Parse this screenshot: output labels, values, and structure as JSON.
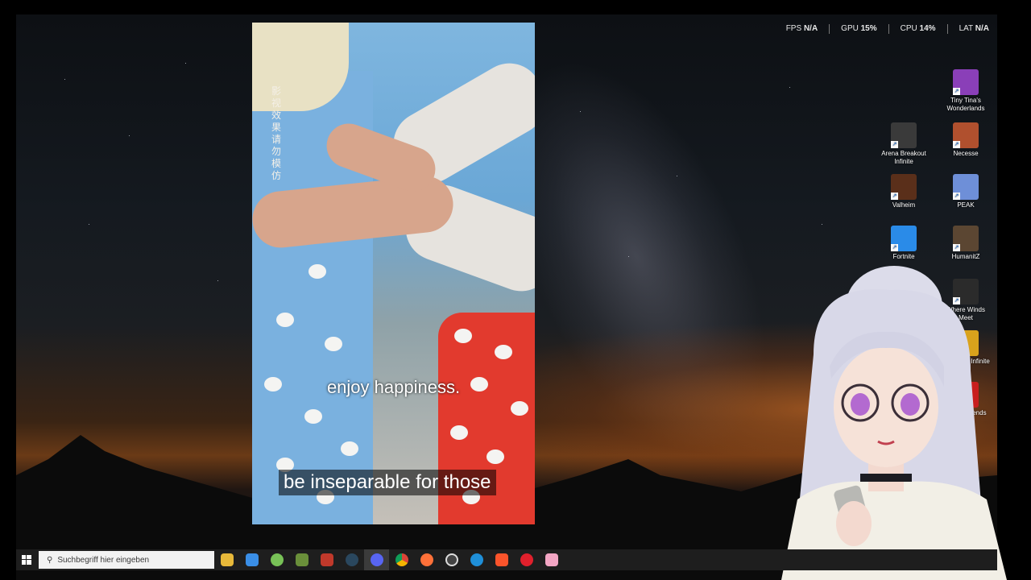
{
  "overlay_stats": [
    {
      "label": "FPS",
      "value": "N/A"
    },
    {
      "label": "GPU",
      "value": "15%"
    },
    {
      "label": "CPU",
      "value": "14%"
    },
    {
      "label": "LAT",
      "value": "N/A"
    }
  ],
  "video": {
    "vertical_watermark": "影视效果请勿模仿",
    "subtitle_upper": "enjoy happiness.",
    "subtitle_lower": "be inseparable for those"
  },
  "desktop_icons": [
    {
      "label": "Tiny Tina's Wonderlands",
      "icon": "tiny-tinas-wonderlands-icon",
      "color": "#8a3fb8"
    },
    {
      "label": "Arena Breakout Infinite",
      "icon": "arena-breakout-infinite-icon",
      "color": "#3a3a3a"
    },
    {
      "label": "Necesse",
      "icon": "necesse-icon",
      "color": "#b0502e"
    },
    {
      "label": "Valheim",
      "icon": "valheim-icon",
      "color": "#5a2f1a"
    },
    {
      "label": "PEAK",
      "icon": "peak-icon",
      "color": "#6e8fd8"
    },
    {
      "label": "Fortnite",
      "icon": "fortnite-icon",
      "color": "#2a8be8"
    },
    {
      "label": "HumanitZ",
      "icon": "humanitz-icon",
      "color": "#5b4632"
    },
    {
      "label": "Where Winds Meet",
      "icon": "where-winds-meet-icon",
      "color": "#2b2b2b"
    },
    {
      "label": "Deadlight Infinite",
      "icon": "deadlight-icon",
      "color": "#d9a21c"
    },
    {
      "label": "Apex Legends",
      "icon": "apex-legends-icon",
      "color": "#c81e1e"
    }
  ],
  "taskbar": {
    "search_placeholder": "Suchbegriff hier eingeben",
    "apps": [
      {
        "name": "file-explorer-icon",
        "color": "#e8b93a"
      },
      {
        "name": "store-icon",
        "color": "#3a8ee6"
      },
      {
        "name": "android-app-icon",
        "color": "#78c257"
      },
      {
        "name": "minecraft-icon",
        "color": "#6a8f3a"
      },
      {
        "name": "snipping-tool-icon",
        "color": "#c0392b"
      },
      {
        "name": "steam-icon",
        "color": "#2a475e"
      },
      {
        "name": "discord-icon",
        "color": "#5865f2"
      },
      {
        "name": "chrome-icon",
        "color": "#e8a33a"
      },
      {
        "name": "firefox-icon",
        "color": "#ff7139"
      },
      {
        "name": "obs-icon",
        "color": "#444444"
      },
      {
        "name": "edge-icon",
        "color": "#1f8fd8"
      },
      {
        "name": "brave-icon",
        "color": "#fb542b"
      },
      {
        "name": "opera-icon",
        "color": "#e0202c"
      },
      {
        "name": "vtube-studio-icon",
        "color": "#f3a6c4"
      }
    ]
  }
}
